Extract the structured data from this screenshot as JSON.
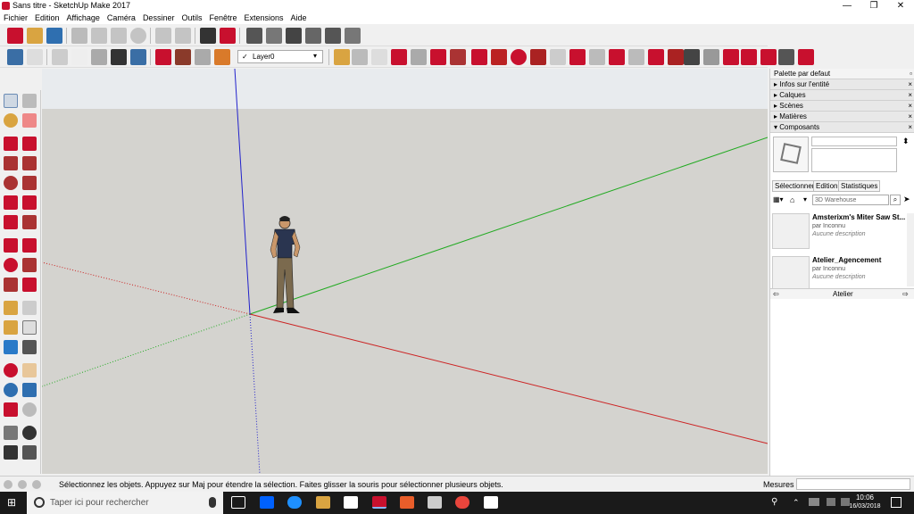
{
  "window": {
    "title": "Sans titre - SketchUp Make 2017",
    "minimize": "—",
    "maximize": "❐",
    "close": "✕"
  },
  "menu": [
    "Fichier",
    "Edition",
    "Affichage",
    "Caméra",
    "Dessiner",
    "Outils",
    "Fenêtre",
    "Extensions",
    "Aide"
  ],
  "layer": {
    "check": "✓",
    "name": "Layer0"
  },
  "status": {
    "message": "Sélectionnez les objets. Appuyez sur Maj pour étendre la sélection. Faites glisser la souris pour sélectionner plusieurs objets.",
    "measures_label": "Mesures"
  },
  "panel": {
    "title": "Palette par defaut",
    "pin": "📌",
    "sections": [
      "Infos sur l'entité",
      "Calques",
      "Scènes",
      "Matières",
      "Composants"
    ],
    "tabs": [
      "Sélectionner",
      "Edition",
      "Statistiques"
    ],
    "search_value": "3D Warehouse",
    "components": [
      {
        "name": "Amsterixm's Miter Saw St...",
        "by": "par Inconnu",
        "desc": "Aucune description"
      },
      {
        "name": "Atelier_Agencement",
        "by": "par Inconnu",
        "desc": "Aucune description"
      }
    ],
    "collection": "Atelier"
  },
  "taskbar": {
    "search_placeholder": "Taper ici pour rechercher",
    "time": "10:06",
    "date": "16/03/2018"
  },
  "colors": {
    "axis_red": "#cc2222",
    "axis_green": "#22aa22",
    "axis_blue": "#2222cc",
    "ground": "#d4d3cf",
    "sky": "#e8ebee"
  }
}
